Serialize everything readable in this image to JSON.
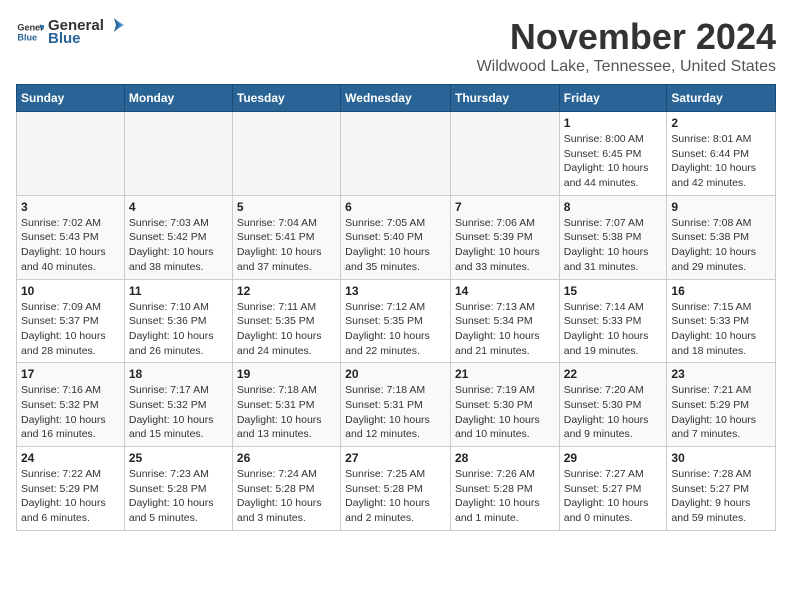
{
  "logo": {
    "general": "General",
    "blue": "Blue"
  },
  "title": "November 2024",
  "location": "Wildwood Lake, Tennessee, United States",
  "days_of_week": [
    "Sunday",
    "Monday",
    "Tuesday",
    "Wednesday",
    "Thursday",
    "Friday",
    "Saturday"
  ],
  "weeks": [
    [
      {
        "day": "",
        "info": ""
      },
      {
        "day": "",
        "info": ""
      },
      {
        "day": "",
        "info": ""
      },
      {
        "day": "",
        "info": ""
      },
      {
        "day": "",
        "info": ""
      },
      {
        "day": "1",
        "info": "Sunrise: 8:00 AM\nSunset: 6:45 PM\nDaylight: 10 hours\nand 44 minutes."
      },
      {
        "day": "2",
        "info": "Sunrise: 8:01 AM\nSunset: 6:44 PM\nDaylight: 10 hours\nand 42 minutes."
      }
    ],
    [
      {
        "day": "3",
        "info": "Sunrise: 7:02 AM\nSunset: 5:43 PM\nDaylight: 10 hours\nand 40 minutes."
      },
      {
        "day": "4",
        "info": "Sunrise: 7:03 AM\nSunset: 5:42 PM\nDaylight: 10 hours\nand 38 minutes."
      },
      {
        "day": "5",
        "info": "Sunrise: 7:04 AM\nSunset: 5:41 PM\nDaylight: 10 hours\nand 37 minutes."
      },
      {
        "day": "6",
        "info": "Sunrise: 7:05 AM\nSunset: 5:40 PM\nDaylight: 10 hours\nand 35 minutes."
      },
      {
        "day": "7",
        "info": "Sunrise: 7:06 AM\nSunset: 5:39 PM\nDaylight: 10 hours\nand 33 minutes."
      },
      {
        "day": "8",
        "info": "Sunrise: 7:07 AM\nSunset: 5:38 PM\nDaylight: 10 hours\nand 31 minutes."
      },
      {
        "day": "9",
        "info": "Sunrise: 7:08 AM\nSunset: 5:38 PM\nDaylight: 10 hours\nand 29 minutes."
      }
    ],
    [
      {
        "day": "10",
        "info": "Sunrise: 7:09 AM\nSunset: 5:37 PM\nDaylight: 10 hours\nand 28 minutes."
      },
      {
        "day": "11",
        "info": "Sunrise: 7:10 AM\nSunset: 5:36 PM\nDaylight: 10 hours\nand 26 minutes."
      },
      {
        "day": "12",
        "info": "Sunrise: 7:11 AM\nSunset: 5:35 PM\nDaylight: 10 hours\nand 24 minutes."
      },
      {
        "day": "13",
        "info": "Sunrise: 7:12 AM\nSunset: 5:35 PM\nDaylight: 10 hours\nand 22 minutes."
      },
      {
        "day": "14",
        "info": "Sunrise: 7:13 AM\nSunset: 5:34 PM\nDaylight: 10 hours\nand 21 minutes."
      },
      {
        "day": "15",
        "info": "Sunrise: 7:14 AM\nSunset: 5:33 PM\nDaylight: 10 hours\nand 19 minutes."
      },
      {
        "day": "16",
        "info": "Sunrise: 7:15 AM\nSunset: 5:33 PM\nDaylight: 10 hours\nand 18 minutes."
      }
    ],
    [
      {
        "day": "17",
        "info": "Sunrise: 7:16 AM\nSunset: 5:32 PM\nDaylight: 10 hours\nand 16 minutes."
      },
      {
        "day": "18",
        "info": "Sunrise: 7:17 AM\nSunset: 5:32 PM\nDaylight: 10 hours\nand 15 minutes."
      },
      {
        "day": "19",
        "info": "Sunrise: 7:18 AM\nSunset: 5:31 PM\nDaylight: 10 hours\nand 13 minutes."
      },
      {
        "day": "20",
        "info": "Sunrise: 7:18 AM\nSunset: 5:31 PM\nDaylight: 10 hours\nand 12 minutes."
      },
      {
        "day": "21",
        "info": "Sunrise: 7:19 AM\nSunset: 5:30 PM\nDaylight: 10 hours\nand 10 minutes."
      },
      {
        "day": "22",
        "info": "Sunrise: 7:20 AM\nSunset: 5:30 PM\nDaylight: 10 hours\nand 9 minutes."
      },
      {
        "day": "23",
        "info": "Sunrise: 7:21 AM\nSunset: 5:29 PM\nDaylight: 10 hours\nand 7 minutes."
      }
    ],
    [
      {
        "day": "24",
        "info": "Sunrise: 7:22 AM\nSunset: 5:29 PM\nDaylight: 10 hours\nand 6 minutes."
      },
      {
        "day": "25",
        "info": "Sunrise: 7:23 AM\nSunset: 5:28 PM\nDaylight: 10 hours\nand 5 minutes."
      },
      {
        "day": "26",
        "info": "Sunrise: 7:24 AM\nSunset: 5:28 PM\nDaylight: 10 hours\nand 3 minutes."
      },
      {
        "day": "27",
        "info": "Sunrise: 7:25 AM\nSunset: 5:28 PM\nDaylight: 10 hours\nand 2 minutes."
      },
      {
        "day": "28",
        "info": "Sunrise: 7:26 AM\nSunset: 5:28 PM\nDaylight: 10 hours\nand 1 minute."
      },
      {
        "day": "29",
        "info": "Sunrise: 7:27 AM\nSunset: 5:27 PM\nDaylight: 10 hours\nand 0 minutes."
      },
      {
        "day": "30",
        "info": "Sunrise: 7:28 AM\nSunset: 5:27 PM\nDaylight: 9 hours\nand 59 minutes."
      }
    ]
  ]
}
